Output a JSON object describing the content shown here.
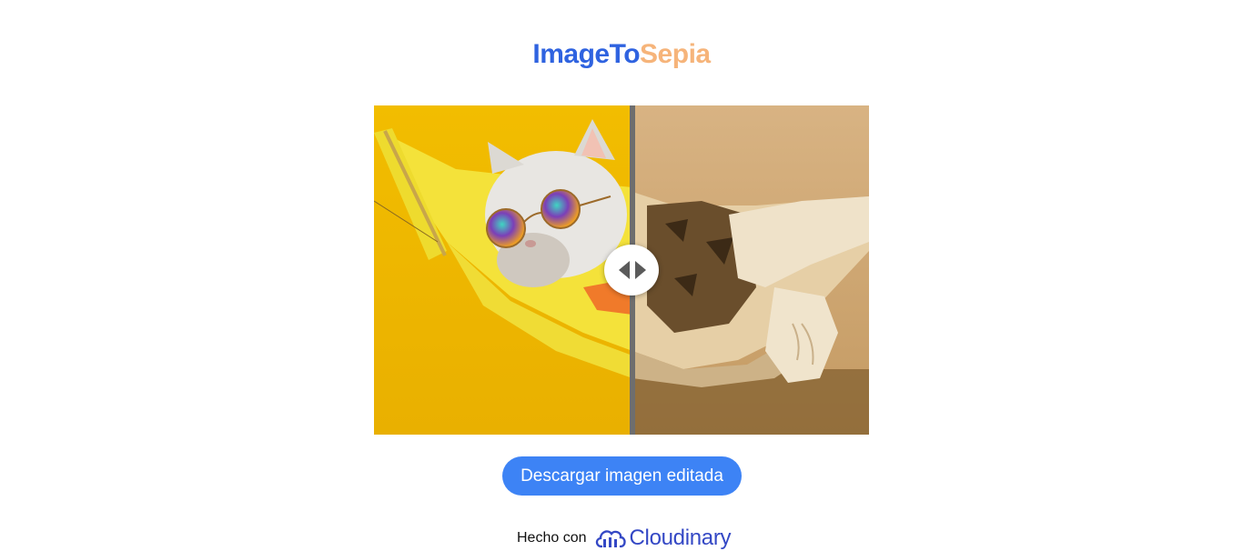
{
  "header": {
    "brand_main": "ImageTo",
    "brand_accent": "Sepia"
  },
  "compare": {
    "split_fraction": 0.52
  },
  "actions": {
    "download_label": "Descargar imagen editada"
  },
  "footer": {
    "made_with": "Hecho con",
    "provider_name": "Cloudinary"
  },
  "colors": {
    "brand_blue": "#2f63e0",
    "brand_orange": "#f6b47a",
    "button_blue": "#3d83f5",
    "cloudinary_blue": "#3448c5"
  },
  "icons": {
    "handle": "left-right-arrows-icon",
    "provider": "cloudinary-logo-icon"
  }
}
